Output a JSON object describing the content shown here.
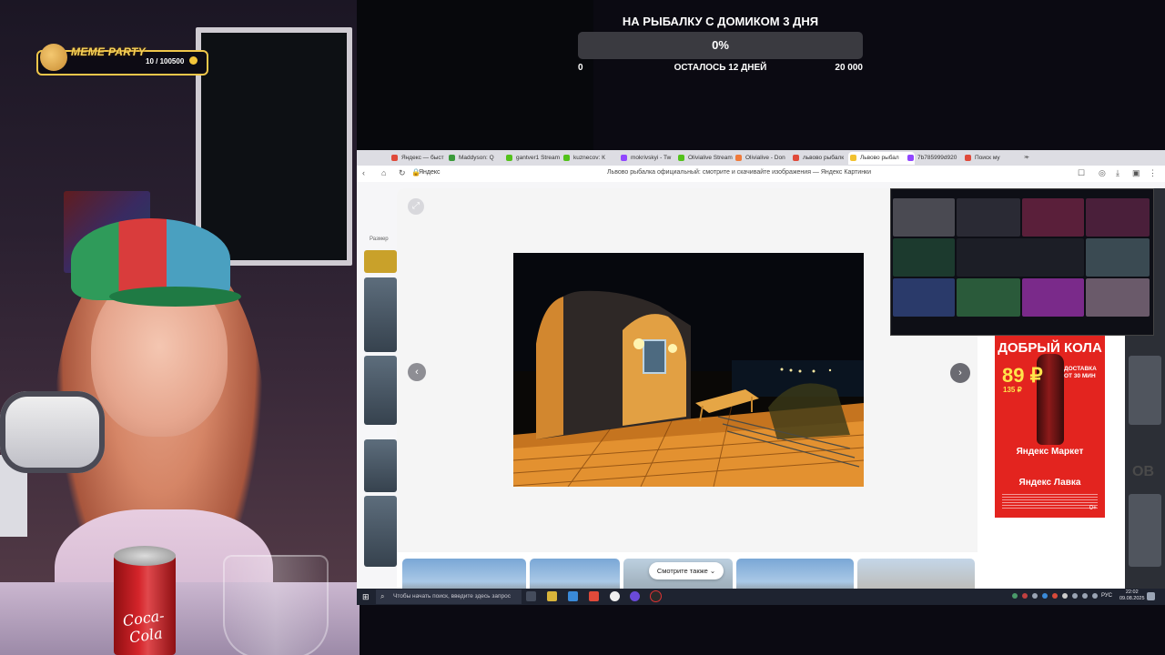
{
  "overlay": {
    "meme_party": {
      "title": "MEME PARTY",
      "count": "10 / 100500"
    },
    "goal": {
      "title": "НА РЫБАЛКУ С ДОМИКОМ 3 ДНЯ",
      "percent_label": "0%",
      "progress_fraction": 0,
      "min": "0",
      "remaining": "ОСТАЛОСЬ 12 ДНЕЙ",
      "max": "20 000"
    }
  },
  "webcam": {
    "can_label": "Coca-Cola"
  },
  "browser": {
    "tabs": [
      {
        "label": "Яндекс — быст",
        "color": "#e04a3a"
      },
      {
        "label": "Maddyson: Q",
        "color": "#3a9a3a"
      },
      {
        "label": "gantver1 Stream",
        "color": "#53c21b"
      },
      {
        "label": "kuznecov: К",
        "color": "#53c21b"
      },
      {
        "label": "mokrivskyi - Tw",
        "color": "#9146ff"
      },
      {
        "label": "Olivialive Stream",
        "color": "#53c21b"
      },
      {
        "label": "Olivialive - Don",
        "color": "#f07a3a"
      },
      {
        "label": "львово рыбалк",
        "color": "#e04a3a"
      },
      {
        "label": "Львово рыбал",
        "color": "#f2c230",
        "active": true
      },
      {
        "label": "7b785999d920",
        "color": "#9146ff"
      },
      {
        "label": "Поиск му",
        "color": "#e04a3a"
      }
    ],
    "address": {
      "site": "Яндекс",
      "page_title": "Львово рыбалка официальный: смотрите и скачивайте изображения — Яндекс Картинки"
    },
    "filter_label": "Размер",
    "viewer": {
      "look_also": "Смотрите также",
      "ad": {
        "headline": "ДОБРЫЙ КОЛА",
        "price": "89 ₽",
        "old_price": "135 ₽",
        "delivery": "ДОСТАВКА ОТ 30 МИН",
        "market": "Яндекс Маркет",
        "lavka": "Яндекс Лавка",
        "age": "0+"
      }
    },
    "right_text": "ОВ"
  },
  "taskbar": {
    "search_placeholder": "Чтобы начать поиск, введите здесь запрос",
    "lang": "РУС",
    "time": "22:02",
    "date": "09.08.2025"
  },
  "colors": {
    "accent_yellow": "#f6d35a",
    "ad_red": "#e3241f",
    "taskbar": "#1e2330"
  }
}
